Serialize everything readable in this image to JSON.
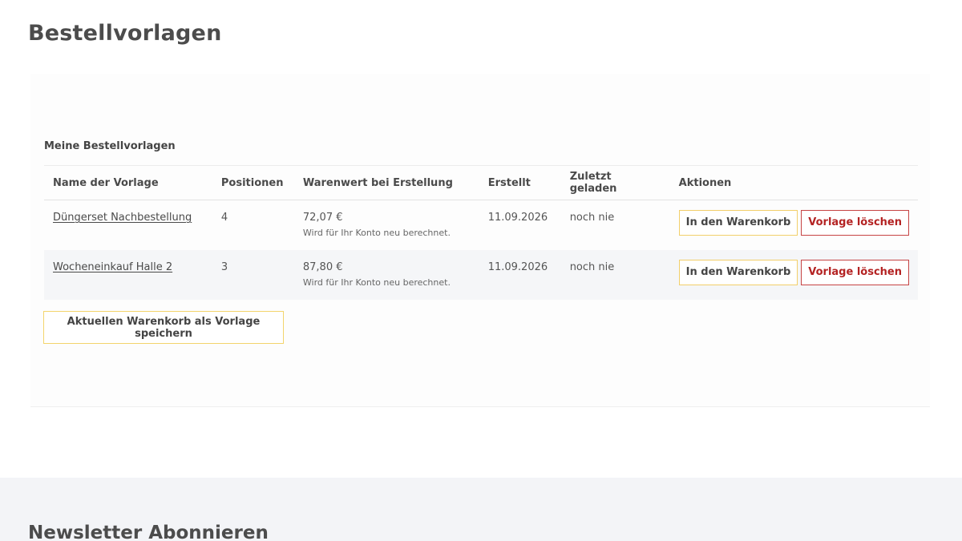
{
  "page": {
    "title": "Bestellvorlagen"
  },
  "section": {
    "title": "Meine Bestellvorlagen"
  },
  "table": {
    "headers": {
      "name": "Name der Vorlage",
      "positions": "Positionen",
      "value": "Warenwert bei Erstellung",
      "created": "Erstellt",
      "last_loaded": "Zuletzt geladen",
      "actions": "Aktionen"
    },
    "rows": [
      {
        "name": "Düngerset Nachbestellung",
        "positions": "4",
        "value": "72,07 €",
        "value_note": "Wird für Ihr Konto neu berechnet.",
        "created": "11.09.2026",
        "last_loaded": "noch nie",
        "add_to_cart_label": "In den Warenkorb",
        "delete_label": "Vorlage löschen"
      },
      {
        "name": "Wocheneinkauf Halle 2",
        "positions": "3",
        "value": "87,80 €",
        "value_note": "Wird für Ihr Konto neu berechnet.",
        "created": "11.09.2026",
        "last_loaded": "noch nie",
        "add_to_cart_label": "In den Warenkorb",
        "delete_label": "Vorlage löschen"
      }
    ]
  },
  "save_button": {
    "label": "Aktuellen Warenkorb als Vorlage speichern"
  },
  "footer": {
    "newsletter_title": "Newsletter Abonnieren"
  },
  "colors": {
    "accent_yellow": "#f2cf6a",
    "delete_red": "#b42323",
    "row_alt_bg": "#f5f6f8",
    "footer_bg": "#f3f4f7"
  }
}
